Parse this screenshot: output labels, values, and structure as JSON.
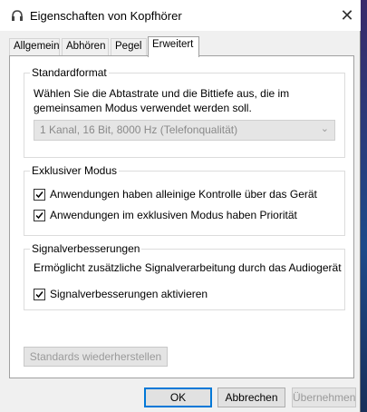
{
  "window": {
    "title": "Eigenschaften von Kopfhörer",
    "close_glyph": "✕"
  },
  "tabs": [
    {
      "label": "Allgemein",
      "active": false
    },
    {
      "label": "Abhören",
      "active": false
    },
    {
      "label": "Pegel",
      "active": false
    },
    {
      "label": "Erweitert",
      "active": true
    }
  ],
  "standardformat": {
    "title": "Standardformat",
    "description_line1": "Wählen Sie die Abtastrate und die Bittiefe aus, die im",
    "description_line2": "gemeinsamen Modus verwendet werden soll.",
    "select_value": "1 Kanal, 16 Bit, 8000 Hz (Telefonqualität)",
    "chevron_glyph": "⌄"
  },
  "exklusiv": {
    "title": "Exklusiver Modus",
    "option1": {
      "label": "Anwendungen haben alleinige Kontrolle über das Gerät",
      "checked": true
    },
    "option2": {
      "label": "Anwendungen im exklusiven Modus haben Priorität",
      "checked": true
    }
  },
  "signal": {
    "title": "Signalverbesserungen",
    "description": "Ermöglicht zusätzliche Signalverarbeitung durch das Audiogerät",
    "option1": {
      "label": "Signalverbesserungen aktivieren",
      "checked": true
    }
  },
  "buttons": {
    "restore": "Standards wiederherstellen",
    "ok": "OK",
    "cancel": "Abbrechen",
    "apply": "Übernehmen"
  }
}
